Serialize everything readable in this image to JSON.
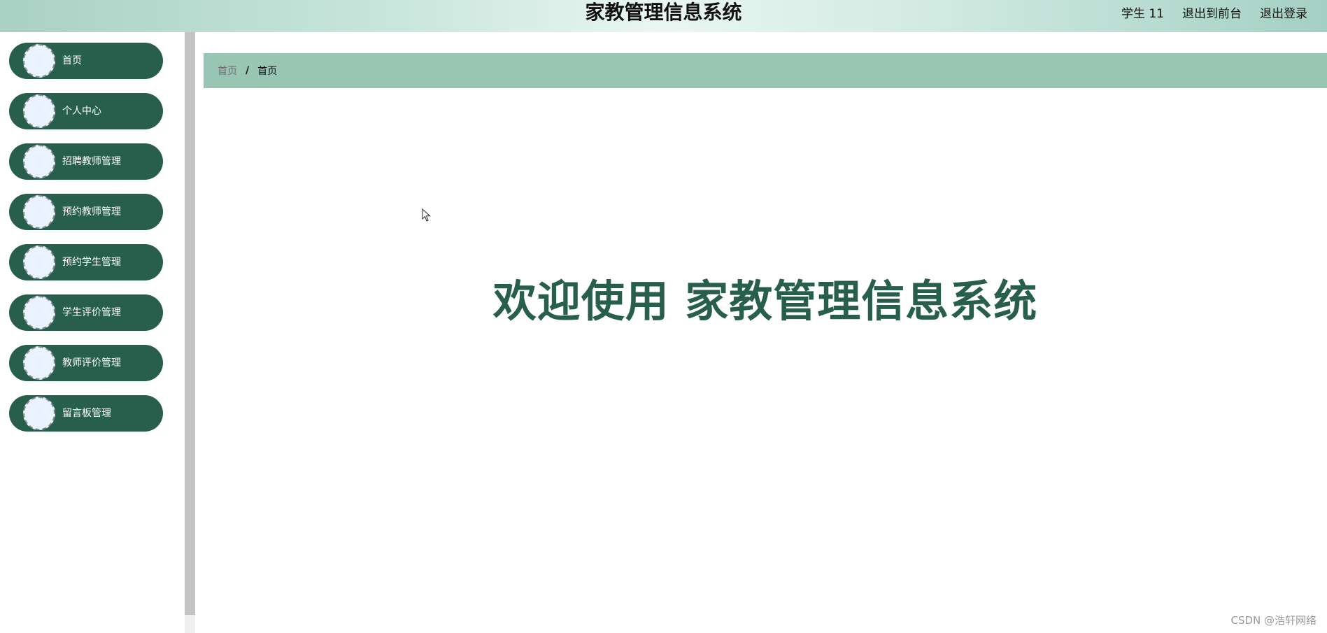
{
  "header": {
    "title": "家教管理信息系统",
    "user_label": "学生 11",
    "back_to_front_label": "退出到前台",
    "logout_label": "退出登录"
  },
  "sidebar": {
    "items": [
      {
        "label": "首页",
        "icon": "avatar-circle-icon"
      },
      {
        "label": "个人中心",
        "icon": "avatar-circle-icon"
      },
      {
        "label": "招聘教师管理",
        "icon": "avatar-circle-icon"
      },
      {
        "label": "预约教师管理",
        "icon": "avatar-circle-icon"
      },
      {
        "label": "预约学生管理",
        "icon": "avatar-circle-icon"
      },
      {
        "label": "学生评价管理",
        "icon": "avatar-circle-icon"
      },
      {
        "label": "教师评价管理",
        "icon": "avatar-circle-icon"
      },
      {
        "label": "留言板管理",
        "icon": "avatar-circle-icon"
      }
    ]
  },
  "breadcrumb": {
    "home": "首页",
    "separator": "/",
    "current": "首页"
  },
  "main": {
    "welcome_text": "欢迎使用 家教管理信息系统"
  },
  "watermark": "CSDN @浩轩网络",
  "colors": {
    "accent": "#275f4c",
    "breadcrumb_bg": "#99c5b5",
    "header_gradient_edge": "#a9d1c4"
  }
}
